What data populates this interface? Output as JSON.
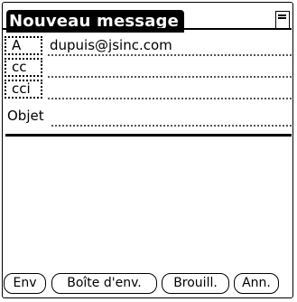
{
  "window": {
    "title": "Nouveau message",
    "menu_icon": "menu-icon"
  },
  "fields": {
    "to": {
      "label": "A",
      "value": "dupuis@jsinc.com"
    },
    "cc": {
      "label": "cc",
      "value": ""
    },
    "bcc": {
      "label": "cci",
      "value": ""
    },
    "subject": {
      "label": "Objet",
      "value": ""
    }
  },
  "body": {
    "text": ""
  },
  "buttons": {
    "send": "Env",
    "outbox": "Boîte d'env.",
    "draft": "Brouill.",
    "cancel": "Ann."
  }
}
